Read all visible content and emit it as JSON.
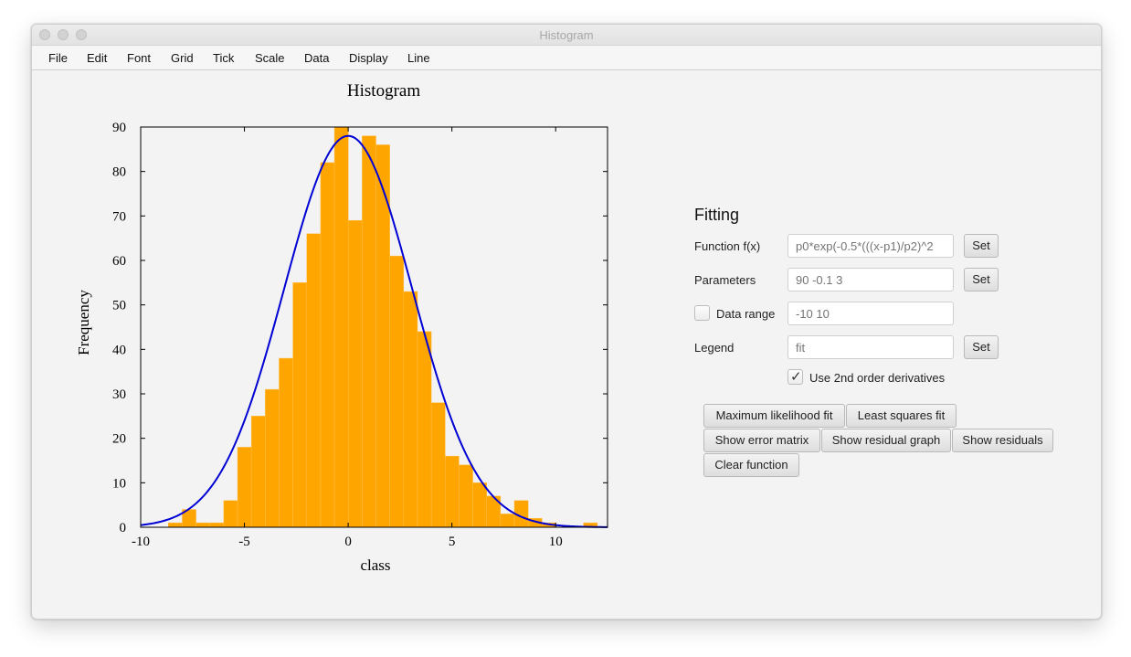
{
  "window": {
    "title": "Histogram"
  },
  "menu": [
    "File",
    "Edit",
    "Font",
    "Grid",
    "Tick",
    "Scale",
    "Data",
    "Display",
    "Line"
  ],
  "chart_data": {
    "type": "bar",
    "title": "Histogram",
    "xlabel": "class",
    "ylabel": "Frequency",
    "xlim": [
      -10,
      12.5
    ],
    "ylim": [
      0,
      90
    ],
    "xticks": [
      -10,
      -5,
      0,
      5,
      10
    ],
    "yticks": [
      0,
      10,
      20,
      30,
      40,
      50,
      60,
      70,
      80,
      90
    ],
    "bin_width": 0.667,
    "bin_start": -10,
    "values": [
      0,
      0,
      1,
      4,
      1,
      1,
      6,
      18,
      25,
      31,
      38,
      55,
      66,
      82,
      90,
      69,
      88,
      86,
      61,
      53,
      44,
      28,
      16,
      14,
      10,
      7,
      3,
      6,
      2,
      1,
      0,
      0,
      1,
      0
    ],
    "bar_color": "#ffa500",
    "fit": {
      "function": "gaussian",
      "amplitude": 88,
      "mean": 0,
      "sigma": 3.1,
      "color": "#0000d4"
    }
  },
  "fitting": {
    "title": "Fitting",
    "function_label": "Function f(x)",
    "function_value": "p0*exp(-0.5*(((x-p1)/p2)^2",
    "parameters_label": "Parameters",
    "parameters_value": "90 -0.1 3",
    "data_range_label": "Data range",
    "data_range_value": "-10 10",
    "legend_label": "Legend",
    "legend_value": "fit",
    "set_label": "Set",
    "derivatives_label": "Use 2nd order derivatives",
    "buttons": {
      "max_likelihood": "Maximum likelihood fit",
      "least_squares": "Least squares fit",
      "error_matrix": "Show error matrix",
      "residual_graph": "Show residual graph",
      "residuals": "Show residuals",
      "clear": "Clear function"
    }
  }
}
